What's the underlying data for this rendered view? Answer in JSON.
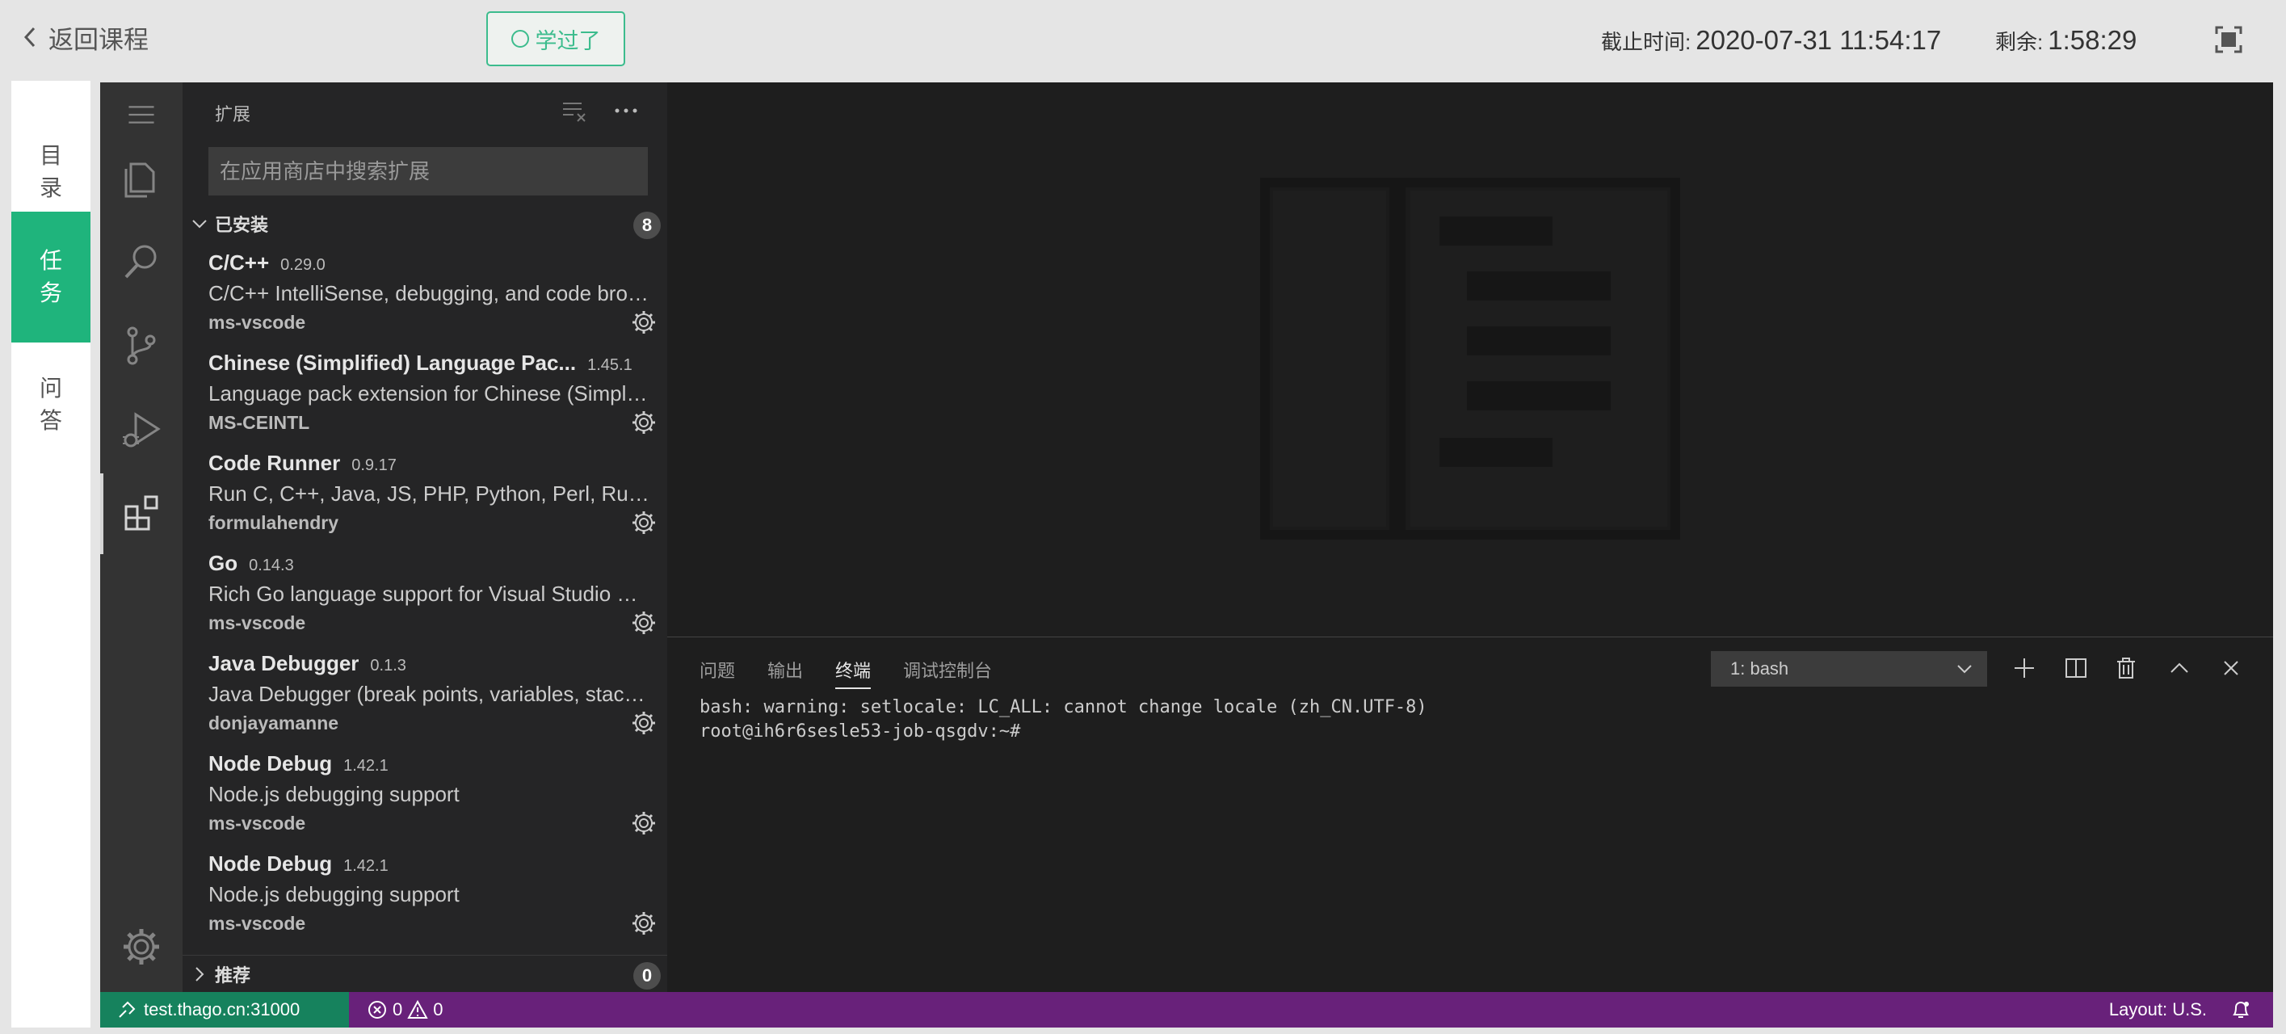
{
  "topbar": {
    "back_label": "返回课程",
    "learned_label": "学过了",
    "deadline_label": "截止时间:",
    "deadline_value": "2020-07-31 11:54:17",
    "remaining_label": "剩余:",
    "remaining_value": "1:58:29"
  },
  "course_nav": {
    "items": [
      {
        "line1": "目",
        "line2": "录",
        "active": false
      },
      {
        "line1": "任",
        "line2": "务",
        "active": true
      },
      {
        "line1": "问",
        "line2": "答",
        "active": false
      }
    ]
  },
  "sidebar": {
    "title": "扩展",
    "search_placeholder": "在应用商店中搜索扩展",
    "installed_label": "已安装",
    "installed_count": "8",
    "recommended_label": "推荐",
    "recommended_count": "0",
    "extensions": [
      {
        "name": "C/C++",
        "version": "0.29.0",
        "description": "C/C++ IntelliSense, debugging, and code browsing.",
        "publisher": "ms-vscode"
      },
      {
        "name": "Chinese (Simplified) Language Pac...",
        "version": "1.45.1",
        "description": "Language pack extension for Chinese (Simplified)",
        "publisher": "MS-CEINTL"
      },
      {
        "name": "Code Runner",
        "version": "0.9.17",
        "description": "Run C, C++, Java, JS, PHP, Python, Perl, Ruby, Go...",
        "publisher": "formulahendry"
      },
      {
        "name": "Go",
        "version": "0.14.3",
        "description": "Rich Go language support for Visual Studio Code",
        "publisher": "ms-vscode"
      },
      {
        "name": "Java Debugger",
        "version": "0.1.3",
        "description": "Java Debugger (break points, variables, stack trace)",
        "publisher": "donjayamanne"
      },
      {
        "name": "Node Debug",
        "version": "1.42.1",
        "description": "Node.js debugging support",
        "publisher": "ms-vscode"
      },
      {
        "name": "Node Debug",
        "version": "1.42.1",
        "description": "Node.js debugging support",
        "publisher": "ms-vscode"
      }
    ]
  },
  "panel": {
    "tabs": [
      "问题",
      "输出",
      "终端",
      "调试控制台"
    ],
    "active_tab": "终端",
    "terminal_select": "1: bash",
    "terminal_lines": [
      "bash: warning: setlocale: LC_ALL: cannot change locale (zh_CN.UTF-8)",
      "root@ih6r6sesle53-job-qsgdv:~#"
    ]
  },
  "statusbar": {
    "remote": "test.thago.cn:31000",
    "errors": "0",
    "warnings": "0",
    "layout": "Layout: U.S."
  },
  "colors": {
    "accent_green": "#1fb47c",
    "status_purple": "#68217a",
    "remote_green": "#16825d"
  }
}
